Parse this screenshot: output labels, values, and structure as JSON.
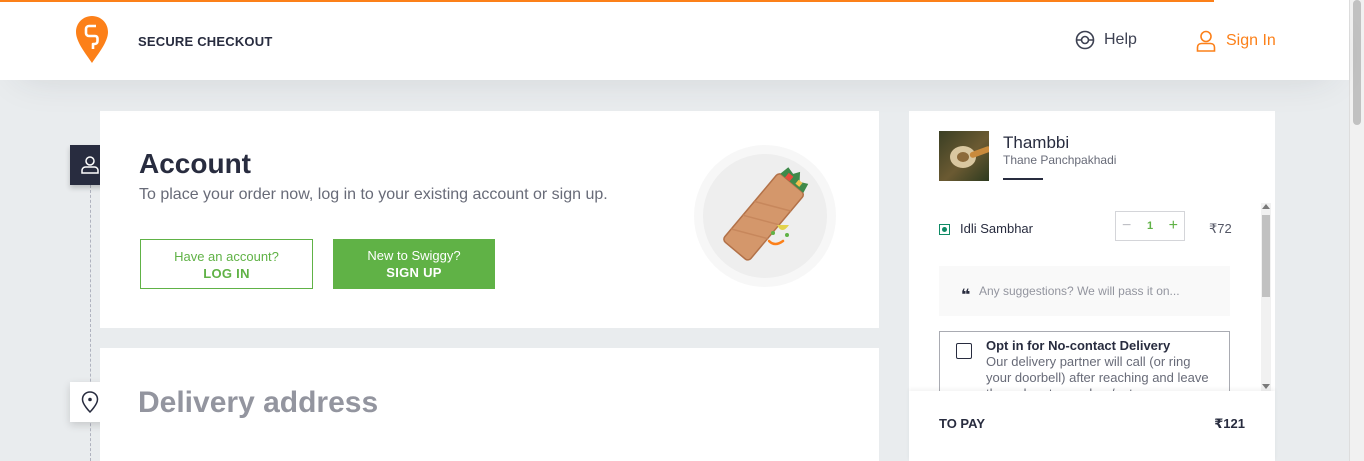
{
  "header": {
    "title": "SECURE CHECKOUT",
    "help_label": "Help",
    "signin_label": "Sign In"
  },
  "colors": {
    "brand": "#fc8019",
    "accent_green": "#60b246",
    "dark": "#282c3f"
  },
  "account": {
    "title": "Account",
    "subtitle": "To place your order now, log in to your existing account or sign up.",
    "login": {
      "small": "Have an account?",
      "big": "LOG IN"
    },
    "signup": {
      "small": "New to Swiggy?",
      "big": "SIGN UP"
    }
  },
  "address": {
    "title": "Delivery address"
  },
  "cart": {
    "restaurant_name": "Thambbi",
    "restaurant_area": "Thane Panchpakhadi",
    "item": {
      "name": "Idli Sambhar",
      "qty": "1",
      "price": "₹72",
      "minus": "−",
      "plus": "+"
    },
    "suggestions_placeholder": "Any suggestions? We will pass it on...",
    "quote_glyph": "❝",
    "nocontact_title": "Opt in for No-contact Delivery",
    "nocontact_desc": "Our delivery partner will call (or ring your doorbell) after reaching and leave the order at your door/gate",
    "to_pay_label": "TO PAY",
    "to_pay_amount": "₹121"
  }
}
